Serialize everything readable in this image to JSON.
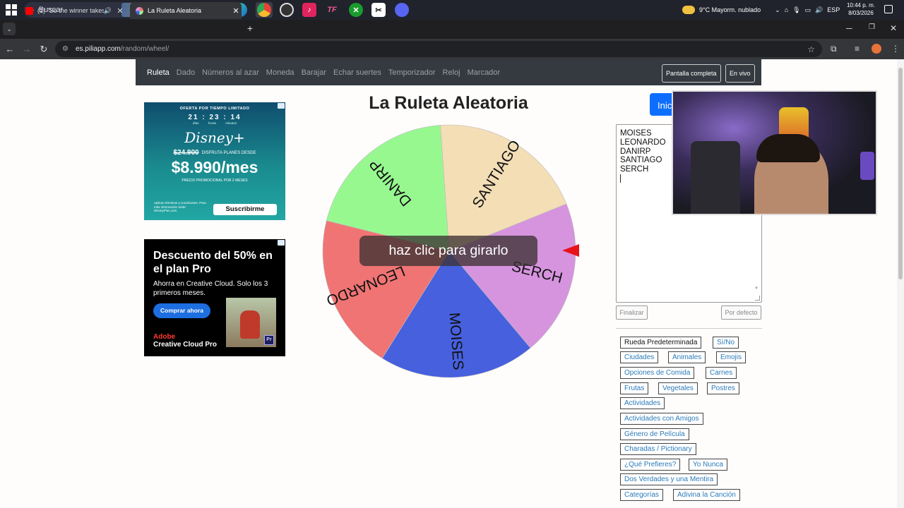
{
  "taskbar": {
    "search_placeholder": "Buscar",
    "weather": "9°C  Mayorm. nublado",
    "lang": "ESP",
    "time": "10:44 p. m.",
    "date": "8/03/2026",
    "apps": [
      "task-view-icon",
      "file-explorer-icon",
      "opera-icon",
      "edge-icon",
      "chrome-icon",
      "obs-icon",
      "tiktok-icon",
      "tf-icon",
      "xbox-icon",
      "capcut-icon",
      "discord-icon"
    ]
  },
  "browser": {
    "tabs": [
      {
        "title": "(1) \"So the winner takes it al"
      },
      {
        "title": "La Ruleta Aleatoria"
      }
    ],
    "url_domain": "es.piliapp.com",
    "url_path": "/random/wheel/"
  },
  "site_nav": {
    "items": [
      "Ruleta",
      "Dado",
      "Números al azar",
      "Moneda",
      "Barajar",
      "Echar suertes",
      "Temporizador",
      "Reloj",
      "Marcador"
    ],
    "fullscreen": "Pantalla completa",
    "live": "En vivo"
  },
  "ad_disney": {
    "offer": "OFERTA POR TIEMPO LIMITADO",
    "timer": "21 : 23 : 14",
    "timer_labels": "días horas minutos",
    "logo": "Disney+",
    "old_price": "$24.900",
    "offer_text": "DISFRUTA PLANES DESDE",
    "price": "$8.990/mes",
    "promo": "PRECIO PROMOCIONAL POR 2 MESES",
    "legal": "Aplican términos y condiciones. Para más información visite: DisneyPlus.com.",
    "cta": "Suscribirme"
  },
  "ad_adobe": {
    "headline": "Descuento del 50% en el plan Pro",
    "sub": "Ahorra en Creative Cloud. Solo los 3 primeros meses.",
    "cta": "Comprar ahora",
    "logo_a": "Adobe",
    "logo_b": "Creative Cloud Pro",
    "badge": "Pr"
  },
  "main": {
    "title": "La Ruleta Aleatoria",
    "spin_message": "haz clic para girarlo",
    "start_button": "Inic",
    "wheel": {
      "segments": [
        {
          "label": "SERCH",
          "color": "#d694de"
        },
        {
          "label": "MOISES",
          "color": "#4660de"
        },
        {
          "label": "LEONARDO",
          "color": "#f07474"
        },
        {
          "label": "DANIRP",
          "color": "#98f890"
        },
        {
          "label": "SANTIAGO",
          "color": "#f3deb6"
        }
      ]
    },
    "names_text": [
      "MOISES",
      "LEONARDO",
      "DANIRP",
      "SANTIAGO",
      "SERCH"
    ],
    "finish_button": "Finalizar",
    "default_button": "Por defecto"
  },
  "categories": [
    {
      "label": "Rueda Predeterminada",
      "selected": true
    },
    {
      "label": "Sí/No"
    },
    {
      "label": "Ciudades"
    },
    {
      "label": "Animales"
    },
    {
      "label": "Emojis"
    },
    {
      "label": "Opciones de Comida"
    },
    {
      "label": "Carnes"
    },
    {
      "label": "Frutas"
    },
    {
      "label": "Vegetales"
    },
    {
      "label": "Postres"
    },
    {
      "label": "Actividades"
    },
    {
      "label": "Actividades con Amigos"
    },
    {
      "label": "Género de Película"
    },
    {
      "label": "Charadas / Pictionary"
    },
    {
      "label": "¿Qué Prefieres?"
    },
    {
      "label": "Yo Nunca"
    },
    {
      "label": "Dos Verdades y una Mentira"
    },
    {
      "label": "Categorías"
    },
    {
      "label": "Adivina la Canción"
    }
  ]
}
